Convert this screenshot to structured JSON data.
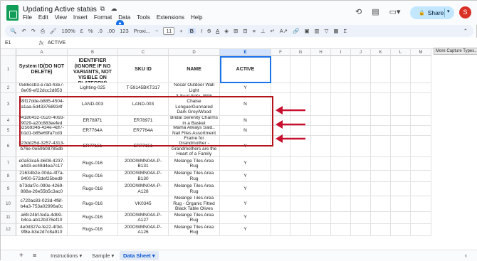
{
  "window": {
    "title": "Updating Active status",
    "title_icons": "☆ ⧉ ☁"
  },
  "menu": [
    "File",
    "Edit",
    "View",
    "Insert",
    "Format",
    "Data",
    "Tools",
    "Extensions",
    "Help"
  ],
  "share_label": "Share",
  "avatar_initial": "S",
  "toolbar": {
    "zoom": "100%",
    "currency": "£",
    "percent": "%",
    "dec_down": ".0",
    "dec_up": ".00",
    "num_format": "123",
    "font": "Proxi...",
    "font_size": "11",
    "bold": "B",
    "italic": "I",
    "strike": "S",
    "text_color": "A"
  },
  "formula_bar": {
    "name_box": "E1",
    "fx": "fx",
    "value": "ACTIVE"
  },
  "tooltip": "More Capture Types...",
  "columns": [
    "A",
    "B",
    "C",
    "D",
    "E",
    "F",
    "G",
    "H",
    "I",
    "J",
    "K",
    "L",
    "M"
  ],
  "rows": [
    {
      "n": "1",
      "a": "System ID(DO NOT DELETE)",
      "b": "GROUPING IDENTIFIER (IGNORE IF NO VARIANTS, NOT VISIBLE ON PLATFORM)",
      "c": "SKU ID",
      "d": "NAME",
      "e": "ACTIVE"
    },
    {
      "n": "2",
      "a": "0586ccb3-e7ad-43e7-8e09-ef22dcc2d853",
      "b": "Lighting-025",
      "c": "T-59145BKT317",
      "d": "Nocar Outdoor Wall Light",
      "e": "Y"
    },
    {
      "n": "3",
      "a": "49f17dde-b885-4504-a1aa-5d433768934f",
      "b": "LAND-003",
      "c": "LAND-003",
      "d": "3-Seat Sofa, With Chaise Longue/Gunnared Dark Grey/Wood",
      "e": "N"
    },
    {
      "n": "4",
      "a": "94180432-0520-4093-9029-a20c883eefed",
      "b": "ER78971",
      "c": "ER78971",
      "d": "Bridal Serenity Charms in a Basket",
      "e": "N"
    },
    {
      "n": "5",
      "a": "b256934b-434e-4df7-b1d1-b85e69fa7cd3",
      "b": "ER7764A",
      "c": "ER7764A",
      "d": "Mama Always Said.. Nail Files Assortment",
      "e": "N"
    },
    {
      "n": "6",
      "a": "c23dd25d-3257-4313-b76e-0e59b08785db",
      "b": "ER77151",
      "c": "ER77151",
      "d": "Frame for Grandmother - Grandmothers are the Heart of a Family",
      "e": "Y"
    },
    {
      "n": "7",
      "a": "e0a53ca5-b608-4237-a4d3-ec48d4ea7c17",
      "b": "Rugs-016",
      "c": "200OWMN04A-P-B131",
      "d": "Melange Tiles Area Rug",
      "e": "Y"
    },
    {
      "n": "8",
      "a": "21634b2e-00da-4f7a-9400-572def25bed9",
      "b": "Rugs-016",
      "c": "200OWMN04A-P-B130",
      "d": "Melange Tiles Area Rug",
      "e": "Y"
    },
    {
      "n": "9",
      "a": "b73daf7c-090e-4269-888a-26e55b5c3ac0",
      "b": "Rugs-016",
      "c": "200OWMN04A-P-A128",
      "d": "Melange Tiles Area Rug",
      "e": "Y"
    },
    {
      "n": "10",
      "a": "c720ac83-023d-4f6f-b4a3-753a02996a0c",
      "b": "Rugs-016",
      "c": "VK0345",
      "d": "Melange Tiles Area Rug - Organic Fitted Black Table Olives",
      "e": "Y"
    },
    {
      "n": "11",
      "a": "a6fc24bf-feda-4db9-b4ca-ab12b376ef10",
      "b": "Rugs-016",
      "c": "200OWMN04A-P-A127",
      "d": "Melange Tiles Area Rug",
      "e": "Y"
    },
    {
      "n": "12",
      "a": "4e0d327e-fe22-4f3d-9f8e-b3e2d7c8a910",
      "b": "Rugs-016",
      "c": "200OWMN04A-P-A126",
      "d": "Melange Tiles Area Rug",
      "e": "Y"
    }
  ],
  "sheets": [
    "Instructions",
    "Sample",
    "Data Sheet"
  ],
  "colors": {
    "accent": "#1a73e8",
    "highlight": "#b3131b",
    "share_bg": "#c2e7ff"
  }
}
